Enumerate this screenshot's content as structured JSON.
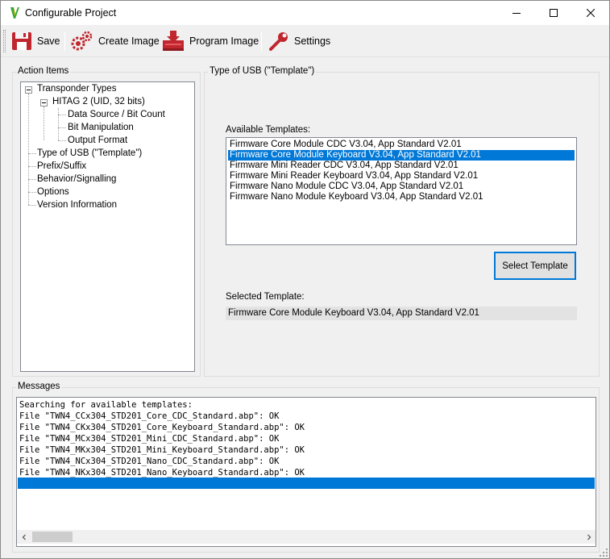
{
  "window": {
    "title": "Configurable Project",
    "controls": {
      "minimize": "minimize-icon",
      "maximize": "maximize-icon",
      "close": "close-icon"
    }
  },
  "toolbar": {
    "items": [
      {
        "label": "Save",
        "icon": "floppy-disk-icon"
      },
      {
        "label": "Create Image",
        "icon": "gears-icon"
      },
      {
        "label": "Program Image",
        "icon": "chip-download-icon"
      },
      {
        "label": "Settings",
        "icon": "wrench-icon"
      }
    ]
  },
  "action_items": {
    "title": "Action Items",
    "tree": {
      "transponder_types": "Transponder Types",
      "hitag": "HITAG 2 (UID, 32 bits)",
      "data_source": "Data Source / Bit Count",
      "bit_manipulation": "Bit Manipulation",
      "output_format": "Output Format",
      "type_of_usb": "Type of USB (\"Template\")",
      "prefix_suffix": "Prefix/Suffix",
      "behavior": "Behavior/Signalling",
      "options": "Options",
      "version_info": "Version Information"
    }
  },
  "usb_panel": {
    "title": "Type of USB (\"Template\")",
    "available_label": "Available Templates:",
    "templates": [
      "Firmware Core Module CDC V3.04, App Standard V2.01",
      "Firmware Core Module Keyboard V3.04, App Standard V2.01",
      "Firmware Mini Reader CDC V3.04, App Standard V2.01",
      "Firmware Mini Reader Keyboard V3.04, App Standard V2.01",
      "Firmware Nano Module CDC V3.04, App Standard V2.01",
      "Firmware Nano Module Keyboard V3.04, App Standard V2.01"
    ],
    "selected_index": 1,
    "select_button": "Select Template",
    "selected_label": "Selected Template:",
    "selected_value": "Firmware Core Module Keyboard V3.04, App Standard V2.01"
  },
  "messages": {
    "title": "Messages",
    "lines": [
      "Searching for available templates:",
      "File \"TWN4_CCx304_STD201_Core_CDC_Standard.abp\": OK",
      "File \"TWN4_CKx304_STD201_Core_Keyboard_Standard.abp\": OK",
      "File \"TWN4_MCx304_STD201_Mini_CDC_Standard.abp\": OK",
      "File \"TWN4_MKx304_STD201_Mini_Keyboard_Standard.abp\": OK",
      "File \"TWN4_NCx304_STD201_Nano_CDC_Standard.abp\": OK",
      "File \"TWN4_NKx304_STD201_Nano_Keyboard_Standard.abp\": OK"
    ]
  },
  "colors": {
    "selection": "#0078d7",
    "window_bg": "#f0f0f0"
  }
}
